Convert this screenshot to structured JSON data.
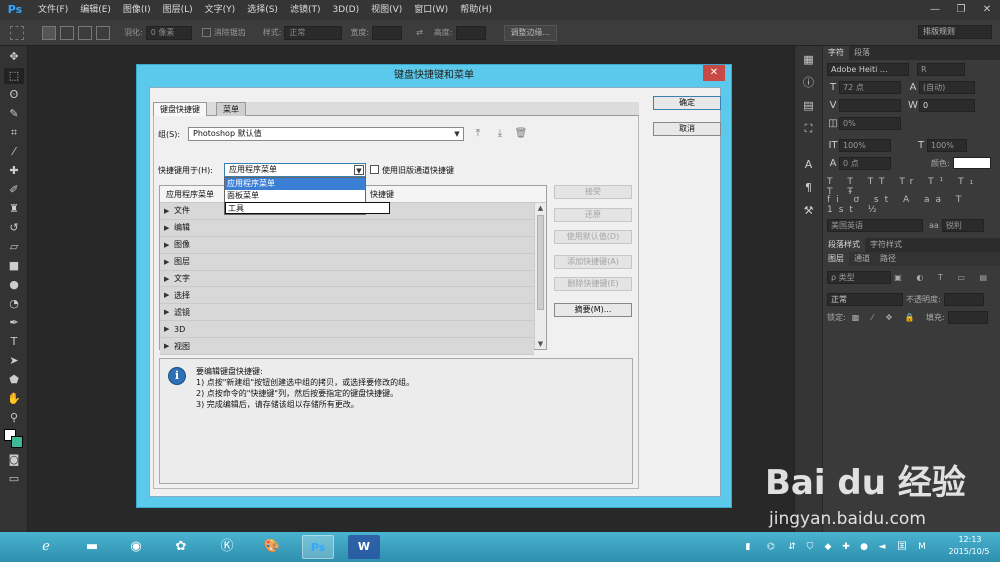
{
  "app": {
    "logo": "Ps",
    "menu": [
      "文件(F)",
      "编辑(E)",
      "图像(I)",
      "图层(L)",
      "文字(Y)",
      "选择(S)",
      "滤镜(T)",
      "3D(D)",
      "视图(V)",
      "窗口(W)",
      "帮助(H)"
    ],
    "window_controls": {
      "minimize": "—",
      "restore": "❐",
      "close": "✕"
    }
  },
  "options_bar": {
    "feather_label": "羽化:",
    "feather_value": "0 像素",
    "antialias_label": "消除锯齿",
    "style_label": "样式:",
    "style_value": "正常",
    "width_label": "宽度:",
    "height_label": "高度:",
    "refine_edge_button": "调整边缘...",
    "workspace_value": "排版规则"
  },
  "dialog": {
    "title": "键盘快捷键和菜单",
    "close": "✕",
    "tabs": [
      "键盘快捷键",
      "菜单"
    ],
    "set_label": "组(S):",
    "set_value": "Photoshop 默认值",
    "shortcuts_for_label": "快捷键用于(H):",
    "shortcuts_for_value": "应用程序菜单",
    "dropdown_options": [
      "应用程序菜单",
      "面板菜单",
      "工具"
    ],
    "legacy_checkbox_label": "使用旧版通道快捷键",
    "table": {
      "headers": [
        "应用程序菜单",
        "快捷键"
      ],
      "rows": [
        "文件",
        "编辑",
        "图像",
        "图层",
        "文字",
        "选择",
        "滤镜",
        "3D",
        "视图"
      ]
    },
    "side_buttons": {
      "accept": "接受",
      "undo": "还原",
      "use_default": "使用默认值(D)",
      "add_shortcut": "添加快捷键(A)",
      "delete_shortcut": "删除快捷键(E)",
      "summarize": "摘要(M)..."
    },
    "ok_button": "确定",
    "cancel_button": "取消",
    "help": {
      "line1": "要编辑键盘快捷键:",
      "line2": "1) 点按\"新建组\"按钮创建选中组的拷贝，或选择要修改的组。",
      "line3": "2) 点按命令的\"快捷键\"列，然后按要指定的键盘快捷键。",
      "line4": "3) 完成编辑后，请存储该组以存储所有更改。"
    }
  },
  "right_panel": {
    "char_tabs": [
      "字符",
      "段落"
    ],
    "font_family": "Adobe Heiti ...",
    "font_style": "R",
    "font_size": "72 点",
    "leading": "(自动)",
    "tracking": "0",
    "kerning": "0%",
    "vscale": "100%",
    "hscale": "100%",
    "baseline": "0 点",
    "color_label": "颜色:",
    "language": "美国英语",
    "aa_label": "aa",
    "aa_value": "锐利",
    "para_style_tabs": [
      "段落样式",
      "字符样式"
    ],
    "layer_tabs": [
      "图层",
      "通道",
      "路径"
    ],
    "filter_kind": "ρ 类型",
    "blend_mode": "正常",
    "opacity_label": "不透明度:",
    "lock_label": "锁定:",
    "fill_label": "填充:"
  },
  "taskbar": {
    "time": "12:13",
    "date": "2015/10/5"
  },
  "watermark": {
    "logo": "Bai du 经验",
    "url": "jingyan.baidu.com"
  }
}
